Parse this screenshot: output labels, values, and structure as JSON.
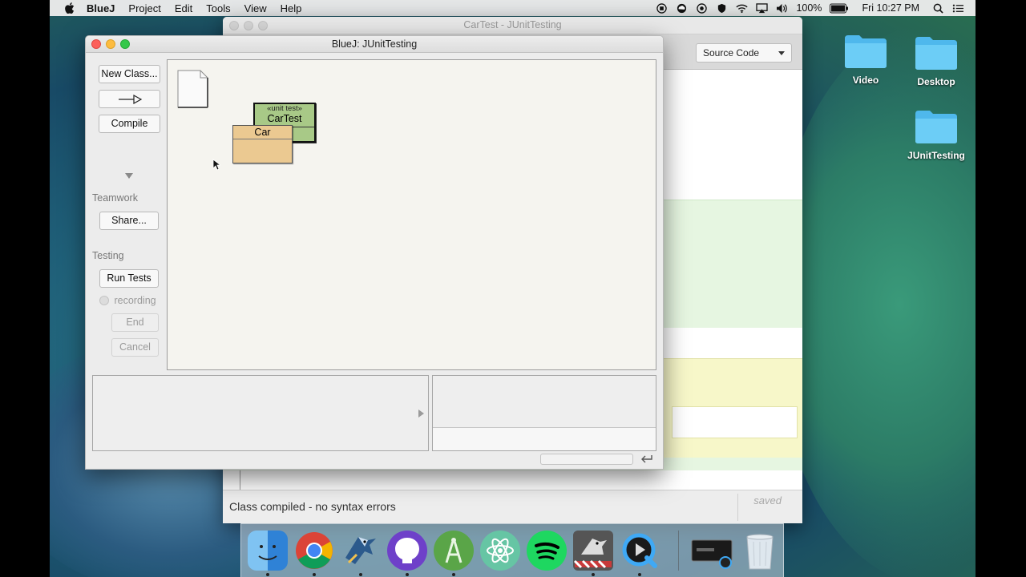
{
  "menubar": {
    "app_name": "BlueJ",
    "items": [
      "Project",
      "Edit",
      "Tools",
      "View",
      "Help"
    ],
    "battery": "100%",
    "clock": "Fri 10:27 PM"
  },
  "back_window": {
    "title": "CarTest - JUnitTesting",
    "source_select": "Source Code",
    "status_message": "Class compiled - no syntax errors",
    "saved_label": "saved"
  },
  "front_window": {
    "title": "BlueJ:  JUnitTesting",
    "buttons": {
      "new_class": "New Class...",
      "compile": "Compile",
      "share": "Share...",
      "run_tests": "Run Tests",
      "end": "End",
      "cancel": "Cancel"
    },
    "labels": {
      "teamwork": "Teamwork",
      "testing": "Testing",
      "recording": "recording"
    },
    "classes": {
      "test_stereotype": "«unit test»",
      "test_name": "CarTest",
      "car_name": "Car"
    }
  },
  "desktop": {
    "icons": [
      "Video",
      "Desktop",
      "JUnitTesting"
    ]
  },
  "dock": {
    "apps": [
      "finder",
      "chrome",
      "bluej",
      "github",
      "android-studio",
      "atom",
      "spotify",
      "bluej-2",
      "quicktime",
      "screen-recording",
      "trash"
    ]
  },
  "colors": {
    "test_class": "#a8c987",
    "car_class": "#ebc991",
    "canvas": "#f5f4ef",
    "folder": "#5ac8fa"
  }
}
